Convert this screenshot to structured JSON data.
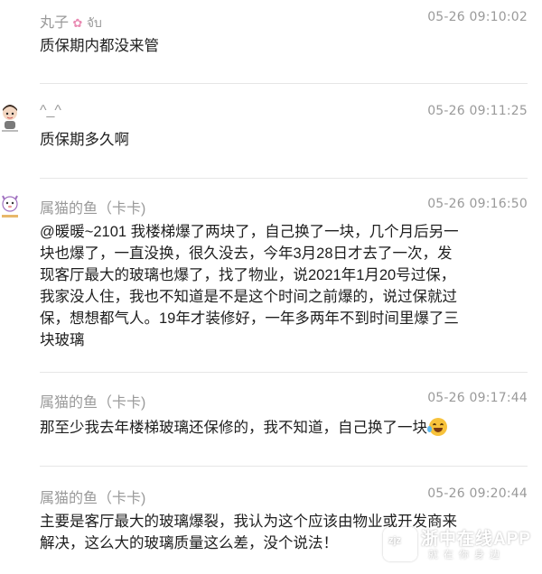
{
  "comments": [
    {
      "user": "丸子",
      "user_suffix": "จับ",
      "time": "05-26 09:10:02",
      "lines": [
        "质保期内都没来管"
      ]
    },
    {
      "user": "^_^",
      "time": "05-26 09:11:25",
      "lines": [
        "质保期多久啊"
      ]
    },
    {
      "user": "属猫的鱼（卡卡)",
      "time": "05-26 09:16:50",
      "lines": [
        "@暖暖~2101 我楼梯爆了两块了，自己换了一块，几个月后另一",
        "块也爆了，一直没换，很久没去，今年3月28日才去了一次，发",
        "现客厅最大的玻璃也爆了，找了物业，说2021年1月20号过保，",
        "我家没人住，我也不知道是不是这个时间之前爆的，说过保就过",
        "保，想想都气人。19年才装修好，一年多两年不到时间里爆了三",
        "块玻璃"
      ]
    },
    {
      "user": "属猫的鱼（卡卡)",
      "time": "05-26 09:17:44",
      "lines": [
        "那至少我去年楼梯玻璃还保修的，我不知道，自己换了一块"
      ]
    },
    {
      "user": "属猫的鱼（卡卡)",
      "time": "05-26 09:20:44",
      "lines": [
        "主要是客厅最大的玻璃爆裂，我认为这个应该由物业或开发商来",
        "解决，这么大的玻璃质量这么差，没个说法！"
      ]
    }
  ],
  "watermark": {
    "title": "浙中在线APP",
    "subtitle": "就在你身边",
    "logo_text": "zjz"
  },
  "colors": {
    "username": "#9a9a9a",
    "text": "#1e1e1e",
    "divider": "#e6e6e6"
  }
}
